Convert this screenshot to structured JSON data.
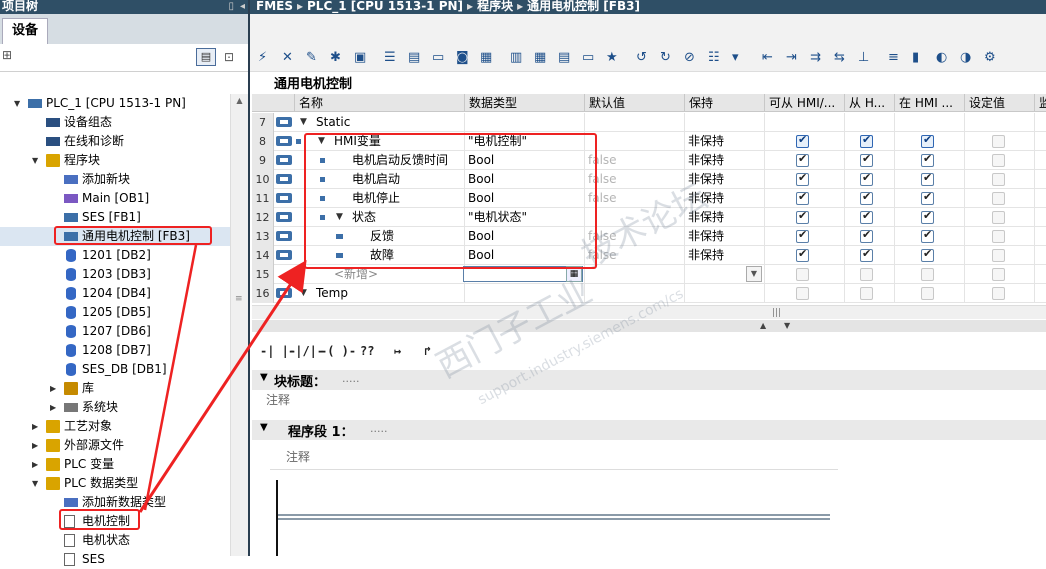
{
  "left_pane": {
    "title": "项目树",
    "tab": "设备",
    "tree": [
      {
        "label": "PLC_1 [CPU 1513-1 PN]",
        "depth": 0,
        "expanded": true,
        "icon": "cpu-icon"
      },
      {
        "label": "设备组态",
        "depth": 1,
        "icon": "device-config-icon"
      },
      {
        "label": "在线和诊断",
        "depth": 1,
        "icon": "online-diagnostics-icon"
      },
      {
        "label": "程序块",
        "depth": 1,
        "expanded": true,
        "icon": "folder-icon"
      },
      {
        "label": "添加新块",
        "depth": 2,
        "icon": "add-block-icon"
      },
      {
        "label": "Main [OB1]",
        "depth": 2,
        "icon": "ob-icon"
      },
      {
        "label": "SES [FB1]",
        "depth": 2,
        "icon": "fb-icon"
      },
      {
        "label": "通用电机控制 [FB3]",
        "depth": 2,
        "icon": "fb-icon",
        "selected": true
      },
      {
        "label": "1201 [DB2]",
        "depth": 2,
        "icon": "db-icon"
      },
      {
        "label": "1203 [DB3]",
        "depth": 2,
        "icon": "db-icon"
      },
      {
        "label": "1204 [DB4]",
        "depth": 2,
        "icon": "db-icon"
      },
      {
        "label": "1205 [DB5]",
        "depth": 2,
        "icon": "db-icon"
      },
      {
        "label": "1207 [DB6]",
        "depth": 2,
        "icon": "db-icon"
      },
      {
        "label": "1208 [DB7]",
        "depth": 2,
        "icon": "db-icon"
      },
      {
        "label": "SES_DB [DB1]",
        "depth": 2,
        "icon": "db-icon"
      },
      {
        "label": "库",
        "depth": 2,
        "collapsed": true,
        "icon": "library-icon"
      },
      {
        "label": "系统块",
        "depth": 2,
        "collapsed": true,
        "icon": "system-block-icon"
      },
      {
        "label": "工艺对象",
        "depth": 1,
        "collapsed": true,
        "icon": "technology-icon"
      },
      {
        "label": "外部源文件",
        "depth": 1,
        "collapsed": true,
        "icon": "external-source-icon"
      },
      {
        "label": "PLC 变量",
        "depth": 1,
        "collapsed": true,
        "icon": "plc-tags-icon"
      },
      {
        "label": "PLC 数据类型",
        "depth": 1,
        "expanded": true,
        "icon": "data-type-folder-icon"
      },
      {
        "label": "添加新数据类型",
        "depth": 2,
        "icon": "add-datatype-icon"
      },
      {
        "label": "电机控制",
        "depth": 2,
        "icon": "udt-icon",
        "highlighted": true
      },
      {
        "label": "电机状态",
        "depth": 2,
        "icon": "udt-icon"
      },
      {
        "label": "SES",
        "depth": 2,
        "icon": "udt-icon"
      }
    ]
  },
  "breadcrumb": [
    "FMES",
    "PLC_1 [CPU 1513-1 PN]",
    "程序块",
    "通用电机控制 [FB3]"
  ],
  "block_name": "通用电机控制",
  "table": {
    "headers": [
      "名称",
      "数据类型",
      "默认值",
      "保持",
      "可从 HMI/...",
      "从 H...",
      "在 HMI ...",
      "设定值",
      "监"
    ],
    "rows": [
      {
        "num": "7",
        "name": "Static",
        "level": 0,
        "toggle": "▼"
      },
      {
        "num": "8",
        "name": "HMI变量",
        "level": 1,
        "toggle": "▼",
        "type": "\"电机控制\"",
        "retain": "非保持",
        "hmi1": "blue",
        "hmi2": "blue",
        "hmi3": "blue",
        "setp": "off"
      },
      {
        "num": "9",
        "name": "电机启动反馈时间",
        "level": 2,
        "type": "Bool",
        "default": "false",
        "retain": "非保持",
        "hmi1": "on",
        "hmi2": "on",
        "hmi3": "on",
        "setp": "off"
      },
      {
        "num": "10",
        "name": "电机启动",
        "level": 2,
        "type": "Bool",
        "default": "false",
        "retain": "非保持",
        "hmi1": "on",
        "hmi2": "on",
        "hmi3": "on",
        "setp": "off"
      },
      {
        "num": "11",
        "name": "电机停止",
        "level": 2,
        "type": "Bool",
        "default": "false",
        "retain": "非保持",
        "hmi1": "on",
        "hmi2": "on",
        "hmi3": "on",
        "setp": "off"
      },
      {
        "num": "12",
        "name": "状态",
        "level": 2,
        "toggle": "▼",
        "type": "\"电机状态\"",
        "retain": "非保持",
        "hmi1": "on",
        "hmi2": "on",
        "hmi3": "on",
        "setp": "off"
      },
      {
        "num": "13",
        "name": "反馈",
        "level": 3,
        "type": "Bool",
        "default": "false",
        "retain": "非保持",
        "hmi1": "on",
        "hmi2": "on",
        "hmi3": "on",
        "setp": "off"
      },
      {
        "num": "14",
        "name": "故障",
        "level": 3,
        "type": "Bool",
        "default": "false",
        "retain": "非保持",
        "hmi1": "on",
        "hmi2": "on",
        "hmi3": "on",
        "setp": "off"
      },
      {
        "num": "15",
        "name": "<新增>",
        "level": 1,
        "add": true,
        "hmi1": "off",
        "hmi2": "off",
        "hmi3": "off",
        "setp": "off"
      },
      {
        "num": "16",
        "name": "Temp",
        "level": 0,
        "toggle": "▼",
        "hmi1": "off",
        "hmi2": "off",
        "hmi3": "off",
        "setp": "off"
      }
    ]
  },
  "lad_toolbar": [
    "-| |-",
    "-|/|-",
    "-( )-",
    "??",
    "↦",
    "↱"
  ],
  "block_title": {
    "label": "块标题：",
    "dots": "....."
  },
  "block_comment": "注释",
  "network": {
    "label": "程序段 1：",
    "dots": ".....",
    "comment": "注释"
  },
  "watermark": [
    "西门子工业",
    "技术论坛",
    "support.industry.siemens.com/cs"
  ],
  "colors": {
    "header_bar": "#2f4f66",
    "annotation_red": "#e22",
    "port_blue": "#3c6fa8"
  }
}
